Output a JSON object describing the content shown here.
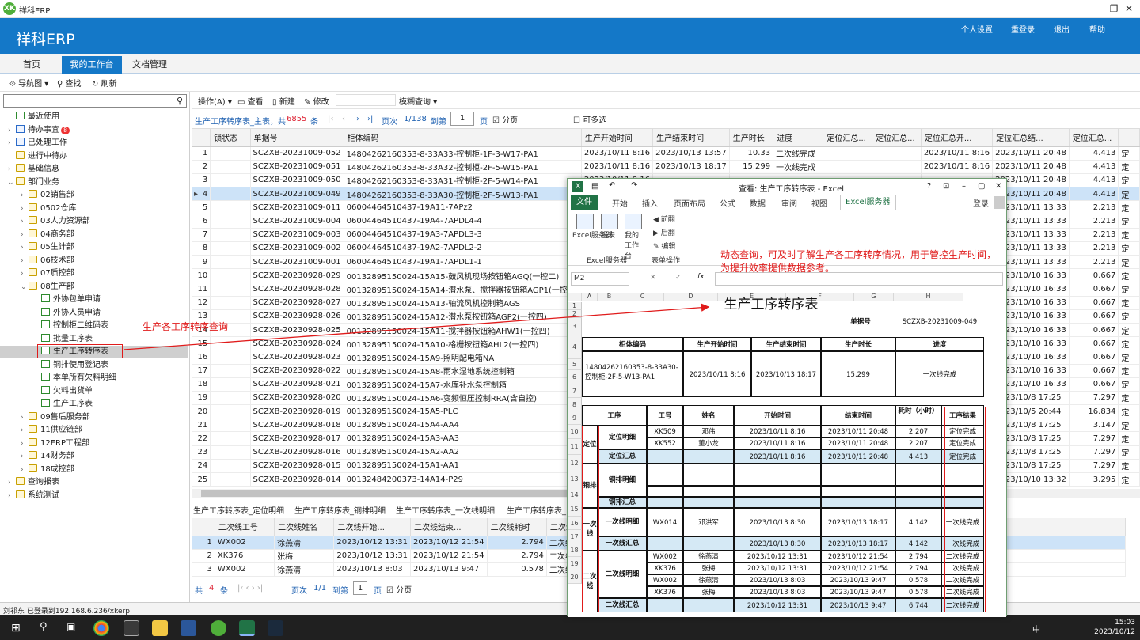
{
  "window": {
    "title": "祥科ERP",
    "minimize": "–",
    "restore": "❐",
    "close": "✕"
  },
  "banner": {
    "brand": "祥科ERP",
    "links": [
      "个人设置",
      "重登录",
      "退出",
      "帮助"
    ]
  },
  "nav": {
    "tabs": [
      "首页",
      "我的工作台",
      "文档管理"
    ],
    "active": "我的工作台"
  },
  "toolbar": {
    "nav_map": "导航图",
    "find": "查找",
    "refresh": "刷新"
  },
  "tree": [
    {
      "label": "最近使用",
      "lvl": 0,
      "icon": "doc"
    },
    {
      "label": "待办事宜",
      "lvl": 0,
      "icon": "mail",
      "badge": "8",
      "exp": "›"
    },
    {
      "label": "已处理工作",
      "lvl": 0,
      "icon": "mail",
      "exp": "›"
    },
    {
      "label": "进行中待办",
      "lvl": 0,
      "icon": "folder"
    },
    {
      "label": "基础信息",
      "lvl": 0,
      "icon": "folder",
      "exp": "›"
    },
    {
      "label": "部门业务",
      "lvl": 0,
      "icon": "folder",
      "exp": "⌄"
    },
    {
      "label": "02销售部",
      "lvl": 1,
      "icon": "folder",
      "exp": "›"
    },
    {
      "label": "0502仓库",
      "lvl": 1,
      "icon": "folder",
      "exp": "›"
    },
    {
      "label": "03人力资源部",
      "lvl": 1,
      "icon": "folder",
      "exp": "›"
    },
    {
      "label": "04商务部",
      "lvl": 1,
      "icon": "folder",
      "exp": "›"
    },
    {
      "label": "05生计部",
      "lvl": 1,
      "icon": "folder",
      "exp": "›"
    },
    {
      "label": "06技术部",
      "lvl": 1,
      "icon": "folder",
      "exp": "›"
    },
    {
      "label": "07质控部",
      "lvl": 1,
      "icon": "folder",
      "exp": "›"
    },
    {
      "label": "08生产部",
      "lvl": 1,
      "icon": "folder",
      "exp": "⌄"
    },
    {
      "label": "外协包单申请",
      "lvl": 2,
      "icon": "doc"
    },
    {
      "label": "外协人员申请",
      "lvl": 2,
      "icon": "doc"
    },
    {
      "label": "控制柜二维码表",
      "lvl": 2,
      "icon": "doc"
    },
    {
      "label": "批量工序表",
      "lvl": 2,
      "icon": "doc"
    },
    {
      "label": "生产工序转序表",
      "lvl": 2,
      "icon": "doc",
      "sel": true
    },
    {
      "label": "铜排使用登记表",
      "lvl": 2,
      "icon": "doc"
    },
    {
      "label": "本单所有欠料明细",
      "lvl": 2,
      "icon": "doc"
    },
    {
      "label": "欠料出货单",
      "lvl": 2,
      "icon": "doc"
    },
    {
      "label": "生产工序表",
      "lvl": 2,
      "icon": "doc"
    },
    {
      "label": "09售后服务部",
      "lvl": 1,
      "icon": "folder",
      "exp": "›"
    },
    {
      "label": "11供应链部",
      "lvl": 1,
      "icon": "folder",
      "exp": "›"
    },
    {
      "label": "12ERP工程部",
      "lvl": 1,
      "icon": "folder",
      "exp": "›"
    },
    {
      "label": "14财务部",
      "lvl": 1,
      "icon": "folder",
      "exp": "›"
    },
    {
      "label": "18成控部",
      "lvl": 1,
      "icon": "folder",
      "exp": "›"
    },
    {
      "label": "查询报表",
      "lvl": 0,
      "icon": "folder",
      "exp": "›"
    },
    {
      "label": "系统测试",
      "lvl": 0,
      "icon": "folder",
      "exp": "›"
    }
  ],
  "toolbar2": {
    "ops": "操作(A)",
    "view": "查看",
    "new": "新建",
    "edit": "修改",
    "fuzzy": "模糊查询"
  },
  "pager": {
    "table": "生产工序转序表_主表，共",
    "total": "6855",
    "unit": "条",
    "page_label": "页次",
    "page_info": "1/138",
    "goto": "到第",
    "page_value": "1",
    "page_unit": "页",
    "paging": "分页",
    "multi": "可多选"
  },
  "grid": {
    "headers": [
      "",
      "锁状态",
      "单据号",
      "柜体编码",
      "生产开始时间",
      "生产结束时间",
      "生产时长",
      "进度",
      "定位汇总...",
      "定位汇总...",
      "定位汇总开...",
      "定位汇总结...",
      "定位汇总...",
      ""
    ],
    "rows": [
      [
        "1",
        "",
        "SCZXB-20231009-052",
        "14804262160353-8-33A33-控制柜-1F-3-W17-PA1",
        "2023/10/11 8:16",
        "2023/10/13 13:57",
        "10.33",
        "二次线完成",
        "",
        "",
        "2023/10/11 8:16",
        "2023/10/11 20:48",
        "4.413",
        "定"
      ],
      [
        "2",
        "",
        "SCZXB-20231009-051",
        "14804262160353-8-33A32-控制柜-2F-5-W15-PA1",
        "2023/10/11 8:16",
        "2023/10/13 18:17",
        "15.299",
        "一次线完成",
        "",
        "",
        "2023/10/11 8:16",
        "2023/10/11 20:48",
        "4.413",
        "定"
      ],
      [
        "3",
        "",
        "SCZXB-20231009-050",
        "14804262160353-8-33A31-控制柜-2F-5-W14-PA1",
        "2023/10/11 8:16",
        "",
        "",
        "",
        "",
        "",
        "",
        "2023/10/11 20:48",
        "4.413",
        "定"
      ],
      [
        "4",
        "",
        "SCZXB-20231009-049",
        "14804262160353-8-33A30-控制柜-2F-5-W13-PA1",
        "",
        "",
        "",
        "",
        "",
        "",
        "",
        "2023/10/11 20:48",
        "4.413",
        "定"
      ],
      [
        "5",
        "",
        "SCZXB-20231009-011",
        "06004464510437-19A11-7APz2",
        "",
        "",
        "",
        "",
        "",
        "",
        "",
        "2023/10/11 13:33",
        "2.213",
        "定"
      ],
      [
        "6",
        "",
        "SCZXB-20231009-004",
        "06004464510437-19A4-7APDL4-4",
        "",
        "",
        "",
        "",
        "",
        "",
        "",
        "2023/10/11 13:33",
        "2.213",
        "定"
      ],
      [
        "7",
        "",
        "SCZXB-20231009-003",
        "06004464510437-19A3-7APDL3-3",
        "",
        "",
        "",
        "",
        "",
        "",
        "",
        "2023/10/11 13:33",
        "2.213",
        "定"
      ],
      [
        "8",
        "",
        "SCZXB-20231009-002",
        "06004464510437-19A2-7APDL2-2",
        "",
        "",
        "",
        "",
        "",
        "",
        "",
        "2023/10/11 13:33",
        "2.213",
        "定"
      ],
      [
        "9",
        "",
        "SCZXB-20231009-001",
        "06004464510437-19A1-7APDL1-1",
        "",
        "",
        "",
        "",
        "",
        "",
        "",
        "2023/10/11 13:33",
        "2.213",
        "定"
      ],
      [
        "10",
        "",
        "SCZXB-20230928-029",
        "00132895150024-15A15-鼓风机现场按钮箱AGQ(一控二)",
        "",
        "",
        "",
        "",
        "",
        "",
        "",
        "2023/10/10 16:33",
        "0.667",
        "定"
      ],
      [
        "11",
        "",
        "SCZXB-20230928-028",
        "00132895150024-15A14-潜水泵、搅拌器按钮箱AGP1(一控四)",
        "",
        "",
        "",
        "",
        "",
        "",
        "",
        "2023/10/10 16:33",
        "0.667",
        "定"
      ],
      [
        "12",
        "",
        "SCZXB-20230928-027",
        "00132895150024-15A13-轴流风机控制箱AGS",
        "",
        "",
        "",
        "",
        "",
        "",
        "",
        "2023/10/10 16:33",
        "0.667",
        "定"
      ],
      [
        "13",
        "",
        "SCZXB-20230928-026",
        "00132895150024-15A12-潜水泵按钮箱AGP2(一控四)",
        "",
        "",
        "",
        "",
        "",
        "",
        "",
        "2023/10/10 16:33",
        "0.667",
        "定"
      ],
      [
        "14",
        "",
        "SCZXB-20230928-025",
        "00132895150024-15A11-搅拌器按钮箱AHW1(一控四)",
        "",
        "",
        "",
        "",
        "",
        "",
        "",
        "2023/10/10 16:33",
        "0.667",
        "定"
      ],
      [
        "15",
        "",
        "SCZXB-20230928-024",
        "00132895150024-15A10-格栅按钮箱AHL2(一控四)",
        "",
        "",
        "",
        "",
        "",
        "",
        "",
        "2023/10/10 16:33",
        "0.667",
        "定"
      ],
      [
        "16",
        "",
        "SCZXB-20230928-023",
        "00132895150024-15A9-照明配电箱NA",
        "",
        "",
        "",
        "",
        "",
        "",
        "",
        "2023/10/10 16:33",
        "0.667",
        "定"
      ],
      [
        "17",
        "",
        "SCZXB-20230928-022",
        "00132895150024-15A8-雨水湿地系统控制箱",
        "",
        "",
        "",
        "",
        "",
        "",
        "",
        "2023/10/10 16:33",
        "0.667",
        "定"
      ],
      [
        "18",
        "",
        "SCZXB-20230928-021",
        "00132895150024-15A7-水库补水泵控制箱",
        "",
        "",
        "",
        "",
        "",
        "",
        "",
        "2023/10/10 16:33",
        "0.667",
        "定"
      ],
      [
        "19",
        "",
        "SCZXB-20230928-020",
        "00132895150024-15A6-变频恒压控制RRA(含自控)",
        "",
        "",
        "",
        "",
        "",
        "",
        "",
        "2023/10/8 17:25",
        "7.297",
        "定"
      ],
      [
        "20",
        "",
        "SCZXB-20230928-019",
        "00132895150024-15A5-PLC",
        "",
        "",
        "",
        "",
        "",
        "",
        "",
        "2023/10/5 20:44",
        "16.834",
        "定"
      ],
      [
        "21",
        "",
        "SCZXB-20230928-018",
        "00132895150024-15A4-AA4",
        "",
        "",
        "",
        "",
        "",
        "",
        "",
        "2023/10/8 17:25",
        "3.147",
        "定"
      ],
      [
        "22",
        "",
        "SCZXB-20230928-017",
        "00132895150024-15A3-AA3",
        "",
        "",
        "",
        "",
        "",
        "",
        "",
        "2023/10/8 17:25",
        "7.297",
        "定"
      ],
      [
        "23",
        "",
        "SCZXB-20230928-016",
        "00132895150024-15A2-AA2",
        "",
        "",
        "",
        "",
        "",
        "",
        "",
        "2023/10/8 17:25",
        "7.297",
        "定"
      ],
      [
        "24",
        "",
        "SCZXB-20230928-015",
        "00132895150024-15A1-AA1",
        "",
        "",
        "",
        "",
        "",
        "",
        "",
        "2023/10/8 17:25",
        "7.297",
        "定"
      ],
      [
        "25",
        "",
        "SCZXB-20230928-014",
        "00132484200373-14A14-P29",
        "",
        "",
        "",
        "",
        "",
        "",
        "",
        "2023/10/10 13:32",
        "3.295",
        "定"
      ]
    ]
  },
  "subtabs": [
    "生产工序转序表_定位明细",
    "生产工序转序表_铜排明细",
    "生产工序转序表_一次线明细",
    "生产工序转序表_二次线明细"
  ],
  "grid2": {
    "headers": [
      "",
      "二次线工号",
      "二次线姓名",
      "二次线开始...",
      "二次线结束...",
      "二次线耗时",
      "二次线工..."
    ],
    "rows": [
      [
        "1",
        "WX002",
        "徐燕清",
        "2023/10/12 13:31",
        "2023/10/12 21:54",
        "2.794",
        "二次线完成"
      ],
      [
        "2",
        "XK376",
        "张梅",
        "2023/10/12 13:31",
        "2023/10/12 21:54",
        "2.794",
        "二次线完成"
      ],
      [
        "3",
        "WX002",
        "徐燕清",
        "2023/10/13 8:03",
        "2023/10/13 9:47",
        "0.578",
        "二次线完成"
      ]
    ]
  },
  "pager2": {
    "total_prefix": "共",
    "total": "4",
    "unit": "条",
    "page_label": "页次",
    "page_info": "1/1",
    "goto": "到第",
    "page_value": "1",
    "page_unit": "页",
    "paging": "分页"
  },
  "status": "刘祁东 已登录到192.168.6.236/xkerp",
  "taskbar": {
    "time": "15:03",
    "date": "2023/10/12",
    "ime": "中"
  },
  "excel": {
    "title": "查看: 生产工序转序表 - Excel",
    "login": "登录",
    "tabs": [
      "文件",
      "开始",
      "插入",
      "页面布局",
      "公式",
      "数据",
      "审阅",
      "视图",
      "Excel服务器"
    ],
    "ribbon": {
      "server": "Excel服务器",
      "report": "报表",
      "workbench": "我的工作台",
      "group1": "Excel服务器",
      "prev": "前翻",
      "next": "后翻",
      "edit": "编辑",
      "group2": "表单操作"
    },
    "namebox": "M2",
    "fx": "fx",
    "cols": [
      "A",
      "B",
      "C",
      "D",
      "E",
      "F",
      "G",
      "H"
    ],
    "sheet": {
      "title": "生产工序转序表",
      "docno_label": "单据号",
      "docno": "SCZXB-20231009-049",
      "h1": [
        "柜体编码",
        "生产开始时间",
        "生产结束时间",
        "生产时长",
        "进度"
      ],
      "v1": [
        "14804262160353-8-33A30-控制柜-2F-5-W13-PA1",
        "2023/10/11 8:16",
        "2023/10/13 18:17",
        "15.299",
        "一次线完成"
      ],
      "h2": [
        "工序",
        "工号",
        "姓名",
        "开始时间",
        "结束时间",
        "耗时（小时）",
        "工序结果"
      ],
      "groups": [
        "定位",
        "铜排",
        "一次线",
        "二次线"
      ],
      "subgroups": [
        "定位明细",
        "定位汇总",
        "铜排明细",
        "铜排汇总",
        "一次线明细",
        "一次线汇总",
        "二次线明细",
        "二次线汇总"
      ],
      "rows": [
        [
          "XK509",
          "邓伟",
          "2023/10/11 8:16",
          "2023/10/11 20:48",
          "2.207",
          "定位完成"
        ],
        [
          "XK552",
          "董小龙",
          "2023/10/11 8:16",
          "2023/10/11 20:48",
          "2.207",
          "定位完成"
        ],
        [
          "",
          "",
          "2023/10/11 8:16",
          "2023/10/11 20:48",
          "4.413",
          "定位完成"
        ],
        [
          "WX014",
          "邓洪军",
          "2023/10/13 8:30",
          "2023/10/13 18:17",
          "4.142",
          "一次线完成"
        ],
        [
          "",
          "",
          "2023/10/13 8:30",
          "2023/10/13 18:17",
          "4.142",
          "一次线完成"
        ],
        [
          "WX002",
          "徐燕清",
          "2023/10/12 13:31",
          "2023/10/12 21:54",
          "2.794",
          "二次线完成"
        ],
        [
          "XK376",
          "张梅",
          "2023/10/12 13:31",
          "2023/10/12 21:54",
          "2.794",
          "二次线完成"
        ],
        [
          "WX002",
          "徐燕清",
          "2023/10/13 8:03",
          "2023/10/13 9:47",
          "0.578",
          "二次线完成"
        ],
        [
          "XK376",
          "张梅",
          "2023/10/13 8:03",
          "2023/10/13 9:47",
          "0.578",
          "二次线完成"
        ],
        [
          "",
          "",
          "2023/10/12 13:31",
          "2023/10/13 9:47",
          "6.744",
          "二次线完成"
        ]
      ]
    }
  },
  "annotations": {
    "left": "生产各工序转序查询",
    "right": "动态查询，可及时了解生产各工序转序情况，用于管控生产时间，为提升效率提供数据参考。"
  }
}
